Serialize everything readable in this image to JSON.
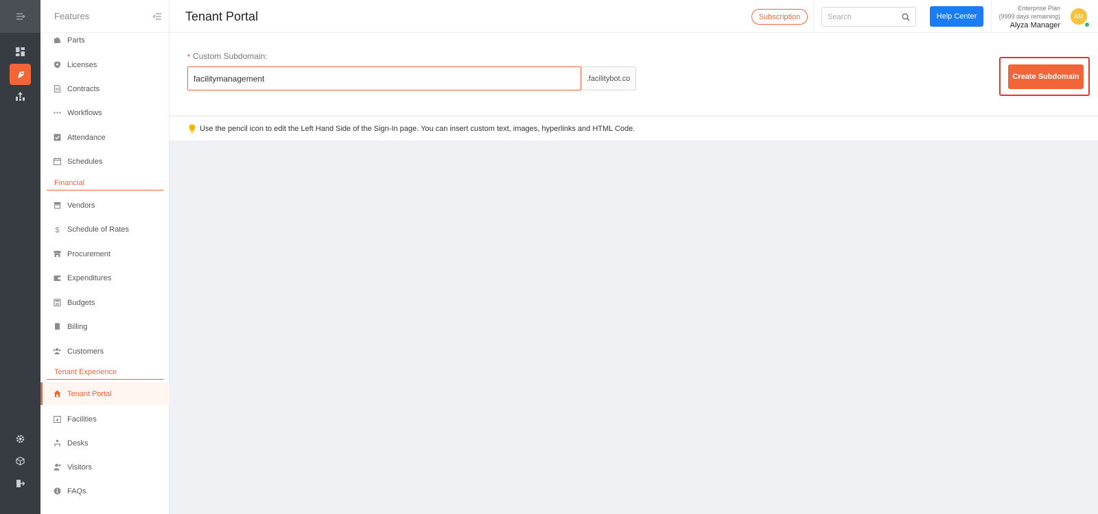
{
  "colors": {
    "accent": "#f26539",
    "rail": "#373b42",
    "help": "#1c7cf3",
    "avatar": "#f7c23a",
    "online": "#2fc25b"
  },
  "rail": {
    "icons": [
      "collapse-menu-icon",
      "dashboard-icon",
      "features-icon",
      "reports-icon",
      "settings-icon",
      "package-icon",
      "logout-icon"
    ]
  },
  "sidebar": {
    "title": "Features",
    "items": [
      {
        "label": "Parts",
        "icon": "puzzle-icon"
      },
      {
        "label": "Licenses",
        "icon": "shield-icon"
      },
      {
        "label": "Contracts",
        "icon": "document-icon"
      },
      {
        "label": "Workflows",
        "icon": "dots-icon"
      },
      {
        "label": "Attendance",
        "icon": "check-square-icon"
      },
      {
        "label": "Schedules",
        "icon": "calendar-icon"
      }
    ],
    "section_financial": "Financial",
    "financial_items": [
      {
        "label": "Vendors",
        "icon": "store-icon"
      },
      {
        "label": "Schedule of Rates",
        "icon": "dollar-icon"
      },
      {
        "label": "Procurement",
        "icon": "shop-icon"
      },
      {
        "label": "Expenditures",
        "icon": "wallet-icon"
      },
      {
        "label": "Budgets",
        "icon": "calculator-icon"
      },
      {
        "label": "Billing",
        "icon": "receipt-icon"
      },
      {
        "label": "Customers",
        "icon": "team-icon"
      }
    ],
    "section_tenant": "Tenant Experience",
    "tenant_items": [
      {
        "label": "Tenant Portal",
        "icon": "home-icon",
        "active": true
      },
      {
        "label": "Facilities",
        "icon": "calendar-plus-icon"
      },
      {
        "label": "Desks",
        "icon": "desk-icon"
      },
      {
        "label": "Visitors",
        "icon": "visitor-icon"
      },
      {
        "label": "FAQs",
        "icon": "info-icon"
      }
    ]
  },
  "header": {
    "title": "Tenant Portal",
    "subscription": "Subscription",
    "search_placeholder": "Search",
    "help": "Help Center",
    "plan": "Enterprise Plan",
    "days": "(9999 days remaining)",
    "user": "Alyza Manager",
    "avatar": "AM"
  },
  "subdomain": {
    "label": "Custom Subdomain",
    "value": "facilitymanagement",
    "suffix": ".facilitybot.co",
    "button": "Create Subdomain"
  },
  "tip": "Use the pencil icon to edit the Left Hand Side of the Sign-In page. You can insert custom text, images, hyperlinks and HTML Code."
}
